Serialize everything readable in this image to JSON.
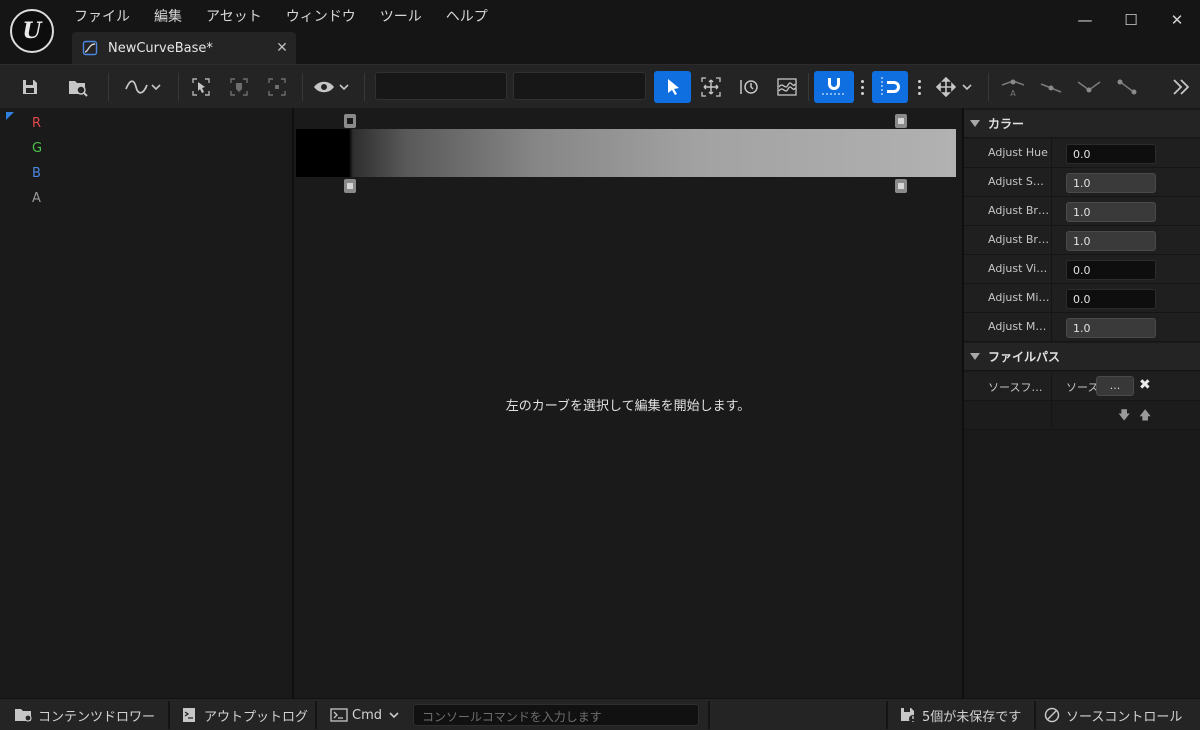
{
  "menu": {
    "items": [
      "ファイル",
      "編集",
      "アセット",
      "ウィンドウ",
      "ツール",
      "ヘルプ"
    ]
  },
  "logo_letter": "U",
  "window_controls": {
    "minimize": "—",
    "maximize": "☐",
    "close": "✕"
  },
  "tab": {
    "title": "NewCurveBase*",
    "close": "✕"
  },
  "channels": [
    {
      "label": "R",
      "color": "#e0474e"
    },
    {
      "label": "G",
      "color": "#48c24a"
    },
    {
      "label": "B",
      "color": "#4c86e0"
    },
    {
      "label": "A",
      "color": "#9a9a9a"
    }
  ],
  "center": {
    "empty_message": "左のカーブを選択して編集を開始します。"
  },
  "details": {
    "color_section": "カラー",
    "color_props": [
      {
        "name": "Adjust Hue",
        "value": "0.0",
        "style": "dark"
      },
      {
        "name": "Adjust Saturation",
        "value": "1.0",
        "style": "light"
      },
      {
        "name": "Adjust Brightness",
        "value": "1.0",
        "style": "light"
      },
      {
        "name": "Adjust Brightness Curve",
        "value": "1.0",
        "style": "light"
      },
      {
        "name": "Adjust Vibrance",
        "value": "0.0",
        "style": "dark"
      },
      {
        "name": "Adjust Min Alpha",
        "value": "0.0",
        "style": "dark"
      },
      {
        "name": "Adjust Max Alpha",
        "value": "1.0",
        "style": "light"
      }
    ],
    "file_section": "ファイルパス",
    "source_file_name": "ソースファイル",
    "source_file_value": "ソース",
    "browse_label": "...",
    "clear_icon": "✖",
    "down_arrow": "🡇",
    "up_arrow": "🡅"
  },
  "statusbar": {
    "content_drawer": "コンテンツドロワー",
    "output_log": "アウトプットログ",
    "cmd": "Cmd",
    "console_placeholder": "コンソールコマンドを入力します",
    "unsaved": "5個が未保存です",
    "source_control": "ソースコントロール"
  },
  "colors": {
    "accent": "#0f6fe0",
    "panel": "#1a1a1a",
    "toolbar": "#242424"
  }
}
